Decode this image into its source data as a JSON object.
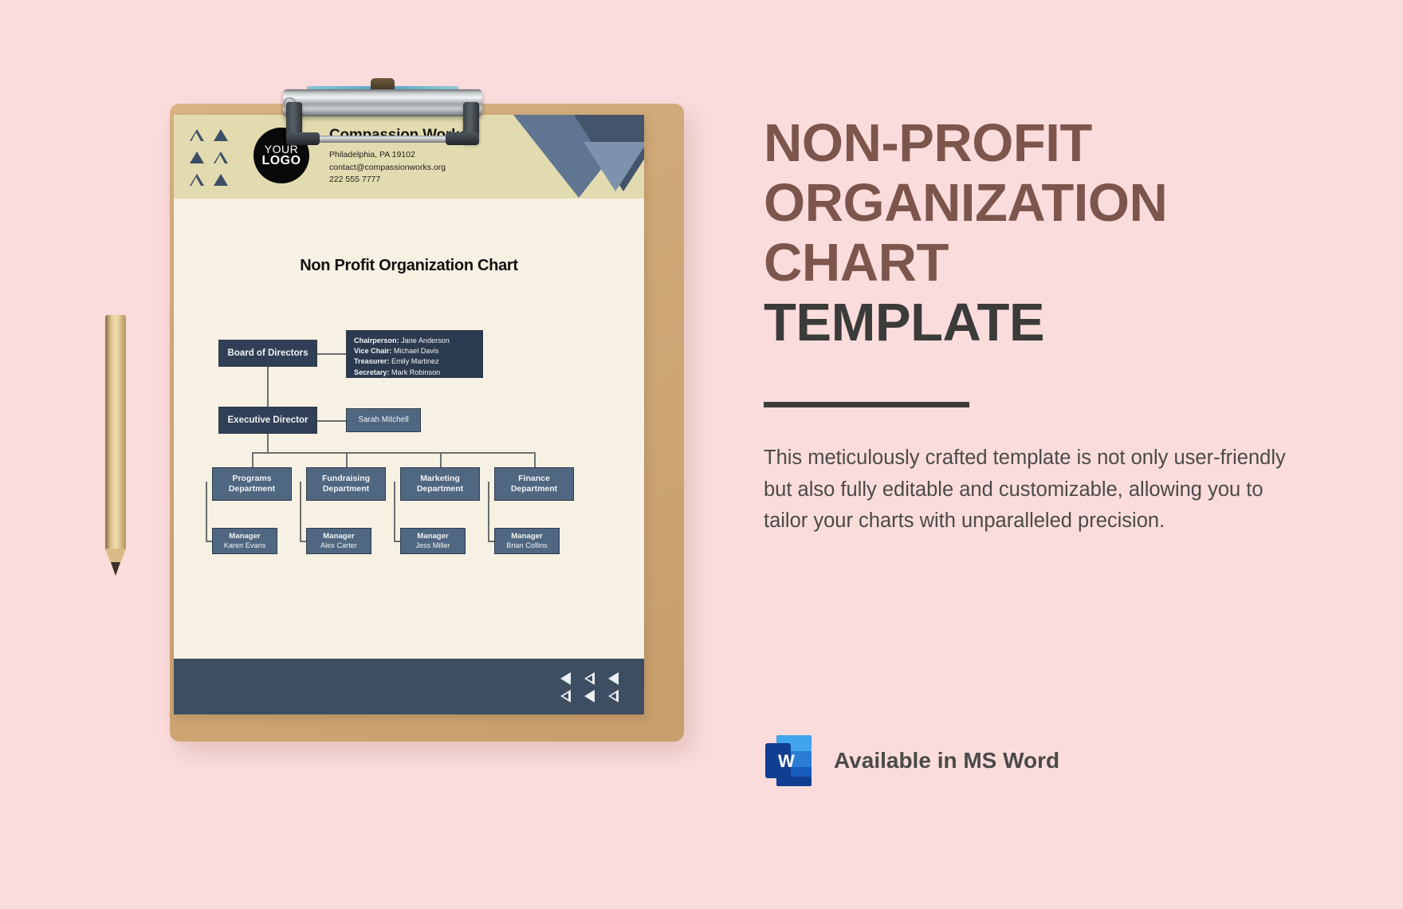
{
  "page": {
    "background_color": "#fbdcdc"
  },
  "promo": {
    "headline_line1": "NON-PROFIT",
    "headline_line2": "ORGANIZATION",
    "headline_line3": "CHART",
    "headline_line4": "TEMPLATE",
    "headline_color": "#7c564c",
    "headline_accent_color": "#3b3c3a",
    "description": "This meticulously crafted template is not only user-friendly but also fully editable and customizable, allowing you to tailor your charts with unparalleled precision.",
    "availability_label": "Available in MS Word",
    "availability_icon": "ms-word-icon"
  },
  "document": {
    "letterhead": {
      "logo_line1": "YOUR",
      "logo_line2": "LOGO",
      "company_name": "Compassion Works",
      "address": "Philadelphia, PA 19102",
      "email": "contact@compassionworks.org",
      "phone": "222 555 7777",
      "triangle_pattern": [
        "hollow",
        "fill",
        "fill",
        "hollow",
        "hollow",
        "fill"
      ],
      "corner_colors": [
        "#5f7592",
        "#44546b",
        "#7d93ad"
      ]
    },
    "title": "Non Profit Organization Chart",
    "footer_triangles": [
      "fill",
      "hollow",
      "fill",
      "hollow",
      "fill",
      "hollow"
    ],
    "footer_color": "#3d4e63"
  },
  "chart_data": {
    "type": "org-chart",
    "title": "Non Profit Organization Chart",
    "node_color_primary": "#303f56",
    "node_color_secondary": "#4f6781",
    "panel_color": "#2c3a4f",
    "nodes": {
      "board": {
        "label": "Board of Directors",
        "level": 1
      },
      "board_members": [
        {
          "role": "Chairperson:",
          "name": "Jane Anderson"
        },
        {
          "role": "Vice Chair:",
          "name": "Michael Davis"
        },
        {
          "role": "Treasurer:",
          "name": "Emily Martinez"
        },
        {
          "role": "Secretary:",
          "name": "Mark Robinson"
        }
      ],
      "executive": {
        "label": "Executive Director",
        "level": 2
      },
      "executive_name": "Sarah Mitchell",
      "departments": [
        {
          "label_line1": "Programs",
          "label_line2": "Department",
          "manager_title": "Manager",
          "manager_name": "Karen Evans"
        },
        {
          "label_line1": "Fundraising",
          "label_line2": "Department",
          "manager_title": "Manager",
          "manager_name": "Alex Carter"
        },
        {
          "label_line1": "Marketing",
          "label_line2": "Department",
          "manager_title": "Manager",
          "manager_name": "Jess Miller"
        },
        {
          "label_line1": "Finance",
          "label_line2": "Department",
          "manager_title": "Manager",
          "manager_name": "Brian Collins"
        }
      ]
    }
  }
}
